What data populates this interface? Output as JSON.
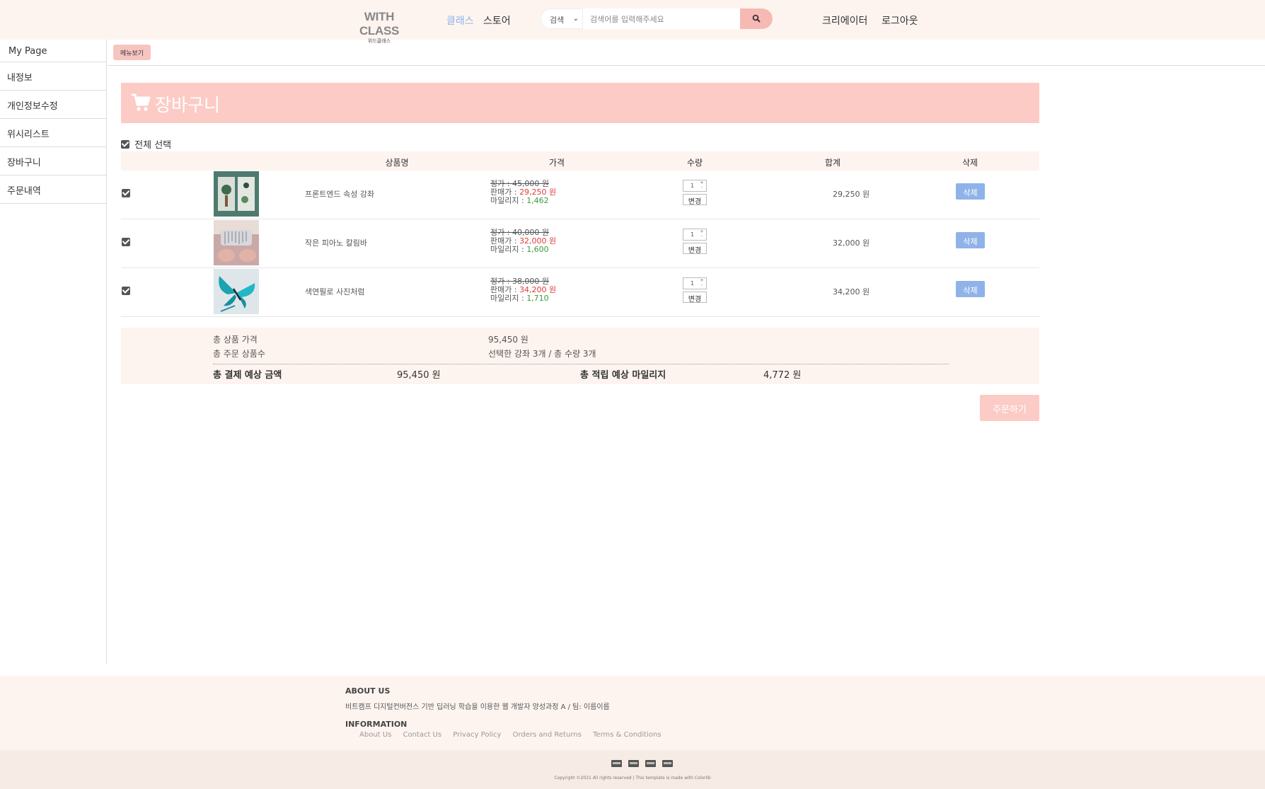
{
  "header": {
    "logo_main": "WITH CLASS",
    "logo_sub": "위드클래스",
    "nav_class": "클래스",
    "nav_store": "스토어",
    "search_select": "검색",
    "search_placeholder": "검색어를 입력해주세요",
    "nav_creator": "크리에이터",
    "nav_logout": "로그아웃",
    "accent_color": "#8fb3e8",
    "brand_pink": "#fccbc6"
  },
  "sidebar": {
    "title": "My Page",
    "items": [
      {
        "label": "내정보"
      },
      {
        "label": "개인정보수정"
      },
      {
        "label": "위시리스트"
      },
      {
        "label": "장바구니"
      },
      {
        "label": "주문내역"
      }
    ]
  },
  "toolbar": {
    "menu_button": "메뉴보기"
  },
  "banner": {
    "title": "장바구니",
    "icon": "cart-icon"
  },
  "select_all_label": "전체 선택",
  "table": {
    "headers": {
      "name": "상품명",
      "price": "가격",
      "qty": "수량",
      "total": "합계",
      "delete": "삭제"
    },
    "rows": [
      {
        "checked": true,
        "name": "프론트엔드 속성 강좌",
        "orig": "정가 : 45,000 원",
        "sale_label": "판매가 : ",
        "sale": "29,250 원",
        "mile_label": "마일리지 : ",
        "mile": "1,462",
        "qty": "1",
        "change": "변경",
        "total": "29,250 원",
        "delete": "삭제"
      },
      {
        "checked": true,
        "name": "작은 피아노 칼림바",
        "orig": "정가 : 40,000 원",
        "sale_label": "판매가 : ",
        "sale": "32,000 원",
        "mile_label": "마일리지 : ",
        "mile": "1,600",
        "qty": "1",
        "change": "변경",
        "total": "32,000 원",
        "delete": "삭제"
      },
      {
        "checked": true,
        "name": "색연필로 사진처럼",
        "orig": "정가 : 38,000 원",
        "sale_label": "판매가 : ",
        "sale": "34,200 원",
        "mile_label": "마일리지 : ",
        "mile": "1,710",
        "qty": "1",
        "change": "변경",
        "total": "34,200 원",
        "delete": "삭제"
      }
    ]
  },
  "summary": {
    "total_price_label": "총 상품 가격",
    "total_price": "95,450 원",
    "total_items_label": "총 주문 상품수",
    "total_items": "선택한 강좌 3개 / 총 수량 3개",
    "pay_label": "총 결제 예상 금액",
    "pay_value": "95,450 원",
    "mileage_label": "총 적립 예상 마일리지",
    "mileage_value": "4,772 원"
  },
  "order_button": "주문하기",
  "footer": {
    "about_title": "ABOUT US",
    "about_desc": "비트캠프 디지털컨버전스 기반 딥러닝 학습을 이용한 웹 개발자 양성과정 A / 팀: 이름이름",
    "info_title": "INFORMATION",
    "links": [
      "About Us",
      "Contact Us",
      "Privacy Policy",
      "Orders and Returns",
      "Terms & Conditions"
    ],
    "copyright": "Copyright ©2021 All rights reserved | This template is made with Colorlib"
  }
}
